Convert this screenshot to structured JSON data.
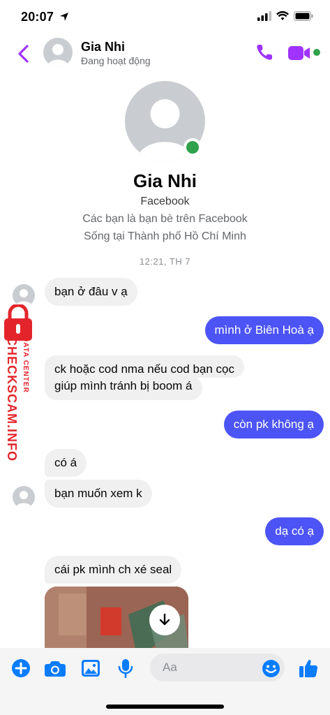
{
  "status_bar": {
    "time": "20:07"
  },
  "header": {
    "name": "Gia Nhi",
    "status": "Đang hoạt động"
  },
  "profile": {
    "name": "Gia Nhi",
    "platform": "Facebook",
    "friends_line": "Các bạn là bạn bè trên Facebook",
    "location_line": "Sống tại Thành phố Hồ Chí Minh"
  },
  "timestamp": "12:21, TH 7",
  "messages": [
    {
      "direction": "incoming",
      "text": "bạn ở đâu v ạ"
    },
    {
      "direction": "outgoing",
      "text": "mình ở Biên Hoà ạ"
    },
    {
      "direction": "incoming",
      "text": "ck hoặc cod nma nếu cod bạn cọc"
    },
    {
      "direction": "incoming",
      "text": "giúp mình tránh bị boom á"
    },
    {
      "direction": "outgoing",
      "text": "còn pk không ạ"
    },
    {
      "direction": "incoming",
      "text": "có á"
    },
    {
      "direction": "incoming",
      "text": "bạn muốn xem k"
    },
    {
      "direction": "outgoing",
      "text": "dạ có ạ"
    },
    {
      "direction": "incoming",
      "text": "cái pk mình ch xé seal"
    }
  ],
  "watermark": {
    "brand": "CHECKSCAM.INFO",
    "tagline": "DATA CENTER"
  },
  "composer": {
    "placeholder": "Aa"
  },
  "colors": {
    "accent": "#a033ff",
    "outgoing_bubble": "#4c54f5",
    "online": "#31a24c",
    "composer_icon": "#0a7cff",
    "watermark": "#e3252b"
  },
  "icons": [
    "back-arrow-icon",
    "phone-icon",
    "video-camera-icon",
    "plus-icon",
    "camera-icon",
    "image-icon",
    "microphone-icon",
    "emoji-icon",
    "thumbs-up-icon",
    "download-icon"
  ]
}
